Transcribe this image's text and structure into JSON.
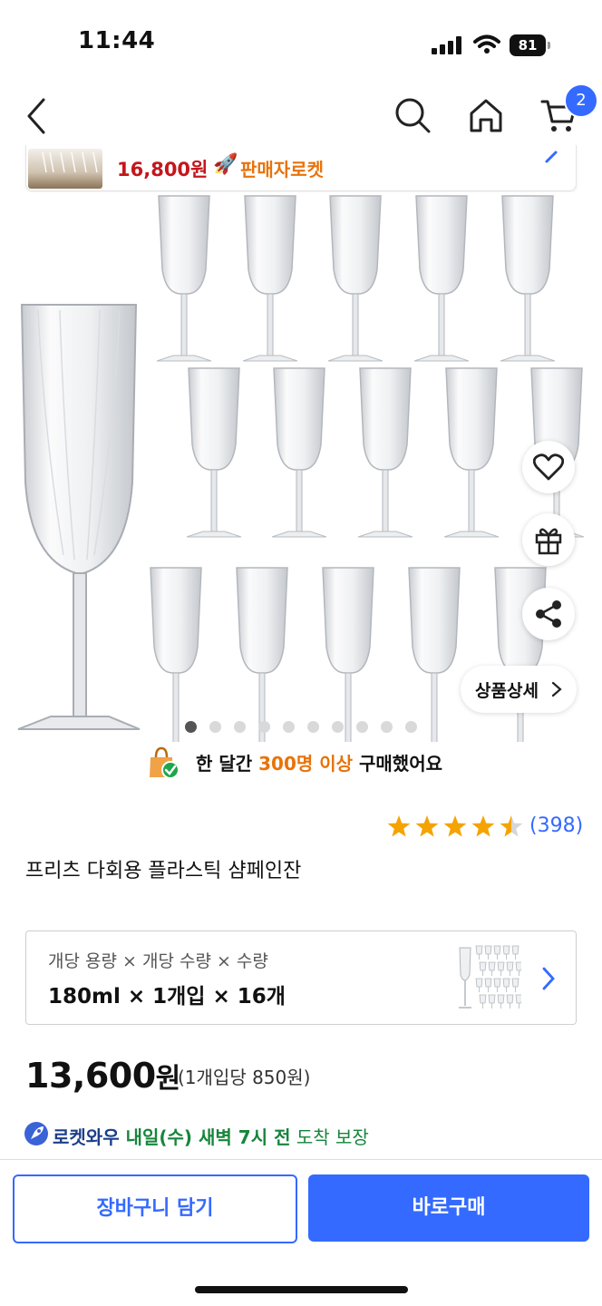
{
  "status_bar": {
    "time": "11:44",
    "battery": "81"
  },
  "nav": {
    "cart_count": "2"
  },
  "summary": {
    "price": "16,800원",
    "seller_badge": "판매자로켓"
  },
  "gallery": {
    "detail_button": "상품상세",
    "dots_total": 10,
    "active_dot": 1
  },
  "purchase_notice": {
    "prefix": "한 달간 ",
    "highlight": "300명 이상",
    "suffix": " 구매했어요"
  },
  "rating": {
    "stars": 4.5,
    "count": "(398)"
  },
  "product": {
    "title": "프리츠 다회용 플라스틱 샴페인잔"
  },
  "option": {
    "label": "개당 용량 × 개당 수량 × 수량",
    "value": "180ml × 1개입 × 16개"
  },
  "price": {
    "amount": "13,600",
    "currency": "원",
    "unit_price": "(1개입당 850원)"
  },
  "delivery": {
    "brand": "로켓와우",
    "date": "내일(수) 새벽 7시 전",
    "suffix": " 도착 보장"
  },
  "actions": {
    "add_to_cart": "장바구니 담기",
    "buy_now": "바로구매"
  },
  "colors": {
    "accent": "#346aff",
    "price_red": "#c4161c",
    "orange": "#e8730a",
    "green": "#16853b",
    "star": "#f5a300"
  }
}
